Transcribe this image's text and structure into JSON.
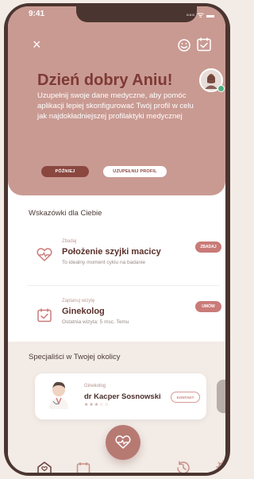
{
  "status": {
    "time": "9:41",
    "signal": "◦◦◦ ᯤ ▬"
  },
  "hero": {
    "greeting": "Dzień dobry Aniu!",
    "description": "Uzupełnij swoje dane medyczne, aby pomóc aplikacji lepiej skonfigurować Twój profil w celu jak najdokładniejszej profilaktyki medycznej",
    "later_label": "PÓŹNIEJ",
    "complete_label": "UZUPEŁNIJ PROFIL"
  },
  "tips": {
    "title": "Wskazówki dla Ciebie",
    "items": [
      {
        "kicker": "Zbadaj",
        "title": "Położenie szyjki macicy",
        "subtitle": "To idealny moment cyklu na badanie",
        "button": "ZBADAJ"
      },
      {
        "kicker": "Zaplanuj wizytę",
        "title": "Ginekolog",
        "subtitle": "Ostatnia wizyta: 5 msc. Temu",
        "button": "UMÓW"
      }
    ]
  },
  "specialists": {
    "title": "Specjaliści w Twojej okolicy",
    "card": {
      "kicker": "Ginekolog",
      "name": "dr Kacper Sosnowski",
      "button": "KONTAKT",
      "stars": "★★★☆☆"
    }
  },
  "colors": {
    "brand": "#c99a92",
    "accent": "#7e3a35"
  }
}
